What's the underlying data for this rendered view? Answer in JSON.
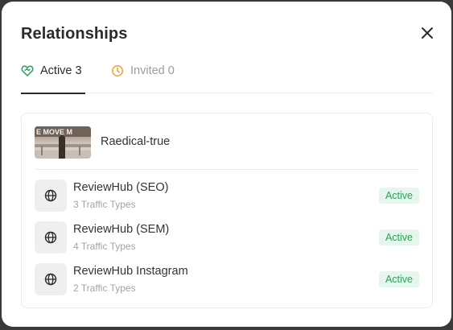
{
  "modal": {
    "title": "Relationships"
  },
  "tabs": [
    {
      "label": "Active 3",
      "icon": "heart-handshake-icon",
      "active": true,
      "color": "#2f9e5a"
    },
    {
      "label": "Invited 0",
      "icon": "clock-icon",
      "active": false,
      "color": "#f0a030"
    }
  ],
  "brand": {
    "name": "Raedical-true",
    "thumbnail_text": "E MOVE M"
  },
  "relationships": [
    {
      "name": "ReviewHub (SEO)",
      "subtitle": "3 Traffic Types",
      "status": "Active",
      "icon": "globe-icon"
    },
    {
      "name": "ReviewHub (SEM)",
      "subtitle": "4 Traffic Types",
      "status": "Active",
      "icon": "globe-icon"
    },
    {
      "name": "ReviewHub Instagram",
      "subtitle": "2 Traffic Types",
      "status": "Active",
      "icon": "globe-icon"
    }
  ],
  "colors": {
    "status_active_bg": "#e6f6ec",
    "status_active_text": "#2f9e5a"
  }
}
